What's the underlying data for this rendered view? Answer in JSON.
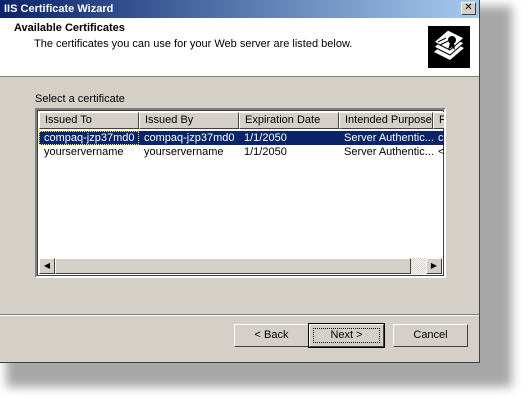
{
  "window": {
    "title": "IIS Certificate Wizard"
  },
  "header": {
    "title": "Available Certificates",
    "subtitle": "The certificates you can use for your Web server are listed below."
  },
  "list": {
    "label": "Select a certificate",
    "columns": [
      "Issued To",
      "Issued By",
      "Expiration Date",
      "Intended Purpose",
      "F"
    ],
    "rows": [
      {
        "issued_to": "compaq-jzp37md0",
        "issued_by": "compaq-jzp37md0",
        "expiration": "1/1/2050",
        "purpose": "Server Authentic...",
        "extra": "c",
        "selected": true
      },
      {
        "issued_to": "yourservername",
        "issued_by": "yourservername",
        "expiration": "1/1/2050",
        "purpose": "Server Authentic...",
        "extra": "<",
        "selected": false
      }
    ]
  },
  "buttons": {
    "back": "< Back",
    "next": "Next >",
    "cancel": "Cancel"
  },
  "icons": {
    "close": "close-icon",
    "wizard": "certificate-wizard-icon"
  }
}
